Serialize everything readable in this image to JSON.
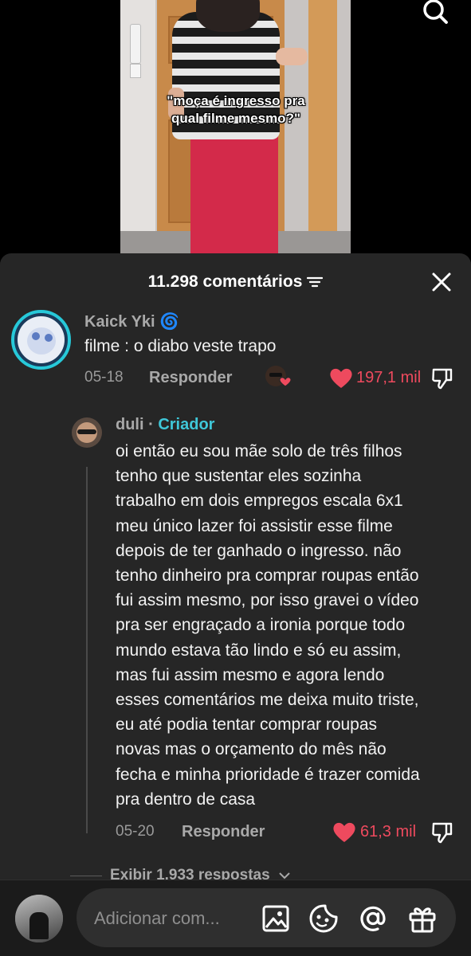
{
  "video": {
    "caption_line1": "\"moça é ingresso pra",
    "caption_line2": "qual filme mesmo?\""
  },
  "header": {
    "comment_count": "11.298 comentários"
  },
  "comments": [
    {
      "username": "Kaick Yki",
      "username_emoji": "🌀",
      "text": "filme : o diabo veste trapo",
      "date": "05-18",
      "reply_label": "Responder",
      "likes": "197,1 mil",
      "liked_by_creator": true
    },
    {
      "username": "duli",
      "separator": " · ",
      "badge": "Criador",
      "text_lines": [
        "oi então eu sou mãe solo de três filhos",
        "tenho que sustentar eles sozinha",
        "trabalho em dois empregos escala 6x1",
        "meu único lazer foi assistir esse filme",
        "depois de ter ganhado o ingresso. não",
        "tenho dinheiro pra comprar roupas então",
        "fui assim mesmo, por isso gravei o vídeo",
        "pra ser engraçado a ironia porque todo",
        "mundo estava tão lindo e só eu assim,",
        "mas fui assim mesmo e agora lendo",
        "esses comentários me deixa muito triste,",
        "eu até podia tentar comprar roupas",
        "novas mas o orçamento do mês não",
        "fecha e minha prioridade é trazer comida",
        "pra dentro de casa"
      ],
      "date": "05-20",
      "reply_label": "Responder",
      "likes": "61,3 mil"
    }
  ],
  "view_replies": "Exibir 1.933 respostas",
  "input": {
    "placeholder": "Adicionar com..."
  },
  "colors": {
    "sheet_bg": "#262626",
    "like_red": "#ee4a5e",
    "creator_cyan": "#3fc7d8"
  }
}
